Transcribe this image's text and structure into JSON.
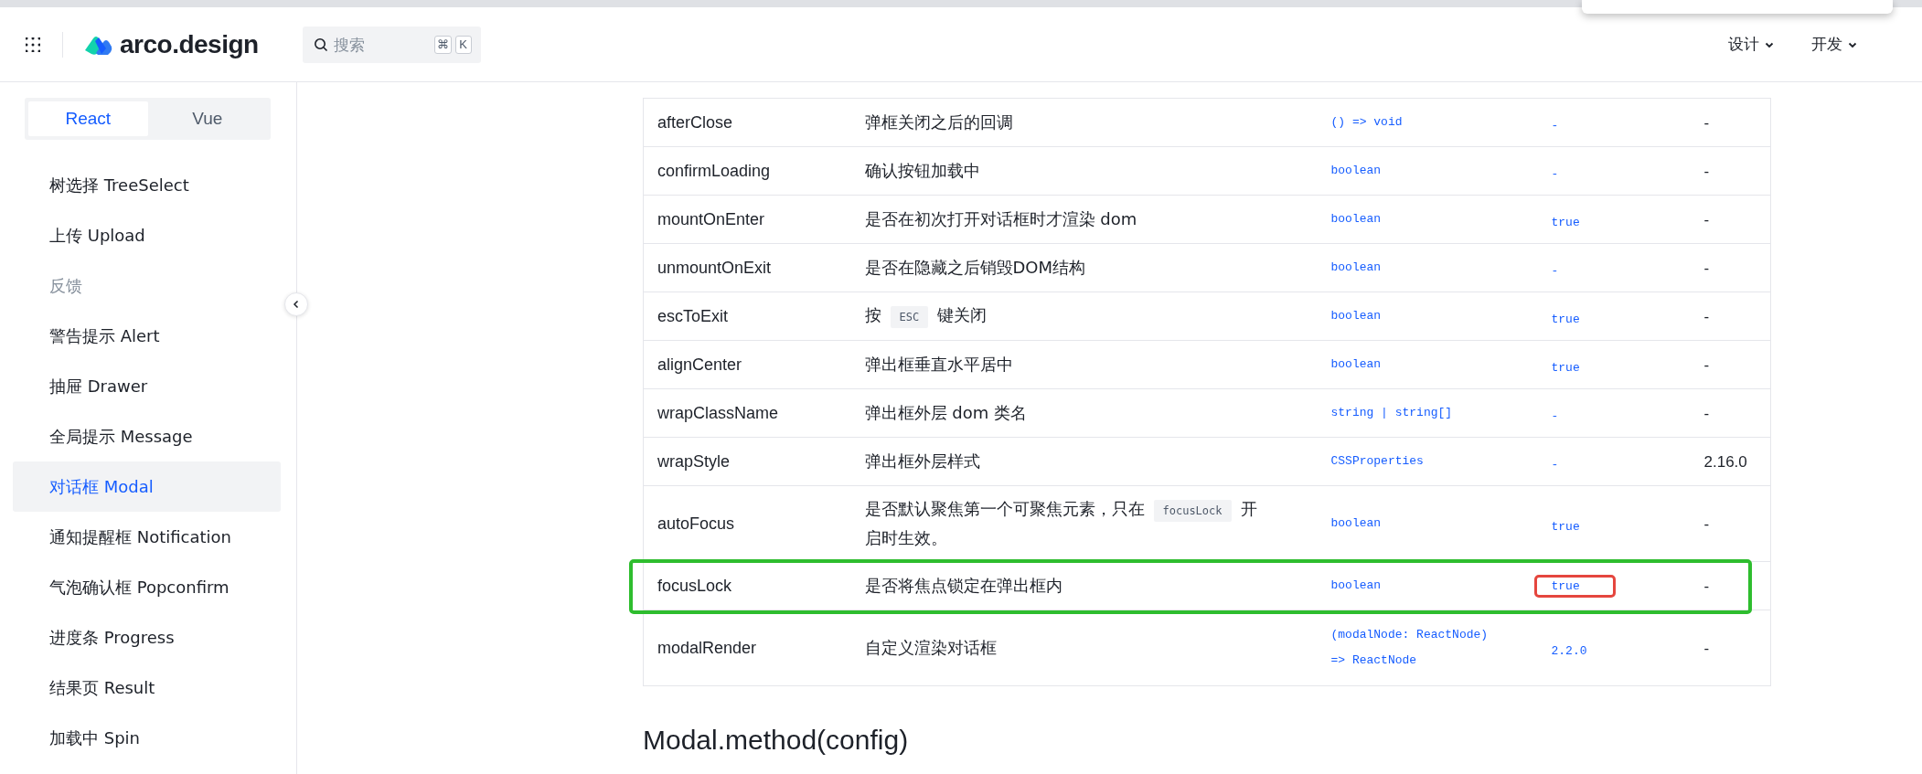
{
  "header": {
    "logo": "arco.design",
    "search": {
      "placeholder": "搜索",
      "keys": [
        "⌘",
        "K"
      ]
    },
    "nav": [
      {
        "label": "设计",
        "dropdown": true
      },
      {
        "label": "开发",
        "dropdown": true
      }
    ]
  },
  "sidebar": {
    "tabs": [
      {
        "label": "React",
        "selected": true
      },
      {
        "label": "Vue",
        "selected": false
      }
    ],
    "items": [
      {
        "label": "树选择 TreeSelect",
        "kind": "link",
        "selected": false
      },
      {
        "label": "上传 Upload",
        "kind": "link",
        "selected": false
      },
      {
        "label": "反馈",
        "kind": "group"
      },
      {
        "label": "警告提示 Alert",
        "kind": "link",
        "selected": false
      },
      {
        "label": "抽屉 Drawer",
        "kind": "link",
        "selected": false
      },
      {
        "label": "全局提示 Message",
        "kind": "link",
        "selected": false
      },
      {
        "label": "对话框 Modal",
        "kind": "link",
        "selected": true
      },
      {
        "label": "通知提醒框 Notification",
        "kind": "link",
        "selected": false
      },
      {
        "label": "气泡确认框 Popconfirm",
        "kind": "link",
        "selected": false
      },
      {
        "label": "进度条 Progress",
        "kind": "link",
        "selected": false
      },
      {
        "label": "结果页 Result",
        "kind": "link",
        "selected": false
      },
      {
        "label": "加载中 Spin",
        "kind": "link",
        "selected": false
      }
    ]
  },
  "table": {
    "rows": [
      {
        "param": "afterClose",
        "description": [
          {
            "kind": "text",
            "text": "弹框关闭之后的回调"
          }
        ],
        "type": "() => void",
        "default": "-",
        "version": "-",
        "highlighted": false,
        "default_boxed": false
      },
      {
        "param": "confirmLoading",
        "description": [
          {
            "kind": "text",
            "text": "确认按钮加载中"
          }
        ],
        "type": "boolean",
        "default": "-",
        "version": "-",
        "highlighted": false,
        "default_boxed": false
      },
      {
        "param": "mountOnEnter",
        "description": [
          {
            "kind": "text",
            "text": "是否在初次打开对话框时才渲染 dom"
          }
        ],
        "type": "boolean",
        "default": "true",
        "version": "-",
        "highlighted": false,
        "default_boxed": false
      },
      {
        "param": "unmountOnExit",
        "description": [
          {
            "kind": "text",
            "text": "是否在隐藏之后销毁DOM结构"
          }
        ],
        "type": "boolean",
        "default": "-",
        "version": "-",
        "highlighted": false,
        "default_boxed": false
      },
      {
        "param": "escToExit",
        "description": [
          {
            "kind": "text",
            "text": "按"
          },
          {
            "kind": "code",
            "text": "ESC"
          },
          {
            "kind": "text",
            "text": "键关闭"
          }
        ],
        "type": "boolean",
        "default": "true",
        "version": "-",
        "highlighted": false,
        "default_boxed": false
      },
      {
        "param": "alignCenter",
        "description": [
          {
            "kind": "text",
            "text": "弹出框垂直水平居中"
          }
        ],
        "type": "boolean",
        "default": "true",
        "version": "-",
        "highlighted": false,
        "default_boxed": false
      },
      {
        "param": "wrapClassName",
        "description": [
          {
            "kind": "text",
            "text": "弹出框外层 dom 类名"
          }
        ],
        "type": "string | string[]",
        "default": "-",
        "version": "-",
        "highlighted": false,
        "default_boxed": false
      },
      {
        "param": "wrapStyle",
        "description": [
          {
            "kind": "text",
            "text": "弹出框外层样式"
          }
        ],
        "type": "CSSProperties",
        "default": "-",
        "version": "2.16.0",
        "highlighted": false,
        "default_boxed": false
      },
      {
        "param": "autoFocus",
        "description": [
          {
            "kind": "text",
            "text": "是否默认聚焦第一个可聚焦元素，只在"
          },
          {
            "kind": "code",
            "text": "focusLock"
          },
          {
            "kind": "text",
            "text": "开启时生效。"
          }
        ],
        "type": "boolean",
        "default": "true",
        "version": "-",
        "highlighted": false,
        "default_boxed": false
      },
      {
        "param": "focusLock",
        "description": [
          {
            "kind": "text",
            "text": "是否将焦点锁定在弹出框内"
          }
        ],
        "type": "boolean",
        "default": "true",
        "version": "-",
        "highlighted": true,
        "default_boxed": true
      },
      {
        "param": "modalRender",
        "description": [
          {
            "kind": "text",
            "text": "自定义渲染对话框"
          }
        ],
        "type": "(modalNode: ReactNode) => ReactNode",
        "default": "2.2.0",
        "version": "-",
        "highlighted": false,
        "default_boxed": false
      }
    ]
  },
  "section": {
    "heading": "Modal.method(config)"
  }
}
